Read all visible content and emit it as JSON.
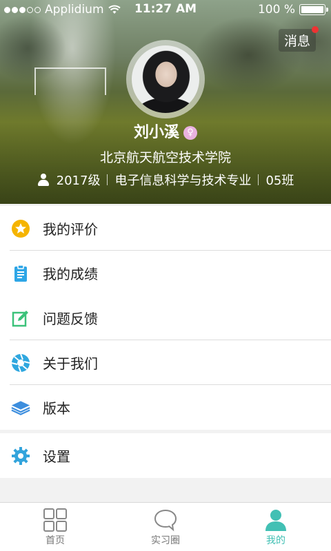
{
  "status_bar": {
    "carrier": "Applidium",
    "time": "11:27 AM",
    "battery": "100 %",
    "signal_dots_filled": 3,
    "signal_dots_total": 5
  },
  "header": {
    "messages_label": "消息",
    "messages_has_unread": true,
    "username": "刘小溪",
    "gender_icon": "female-icon",
    "school": "北京航天航空技术学院",
    "grade": "2017级",
    "major": "电子信息科学与技术专业",
    "class": "05班"
  },
  "menu": {
    "groups": [
      [
        {
          "label": "我的评价",
          "icon": "star-icon",
          "color": "#f5b400"
        },
        {
          "label": "我的成绩",
          "icon": "clipboard-icon",
          "color": "#2ea6e6"
        }
      ],
      [
        {
          "label": "问题反馈",
          "icon": "edit-icon",
          "color": "#3cc27a"
        },
        {
          "label": "关于我们",
          "icon": "aperture-icon",
          "color": "#2fa7df"
        },
        {
          "label": "版本",
          "icon": "layers-icon",
          "color": "#3d8ede"
        }
      ],
      [
        {
          "label": "设置",
          "icon": "gear-icon",
          "color": "#33a4dc"
        }
      ]
    ]
  },
  "tabbar": {
    "tabs": [
      {
        "label": "首页",
        "icon": "grid-icon",
        "active": false
      },
      {
        "label": "实习圈",
        "icon": "chat-bubble-icon",
        "active": false
      },
      {
        "label": "我的",
        "icon": "person-icon",
        "active": true
      }
    ],
    "active_color": "#42c0b4"
  }
}
